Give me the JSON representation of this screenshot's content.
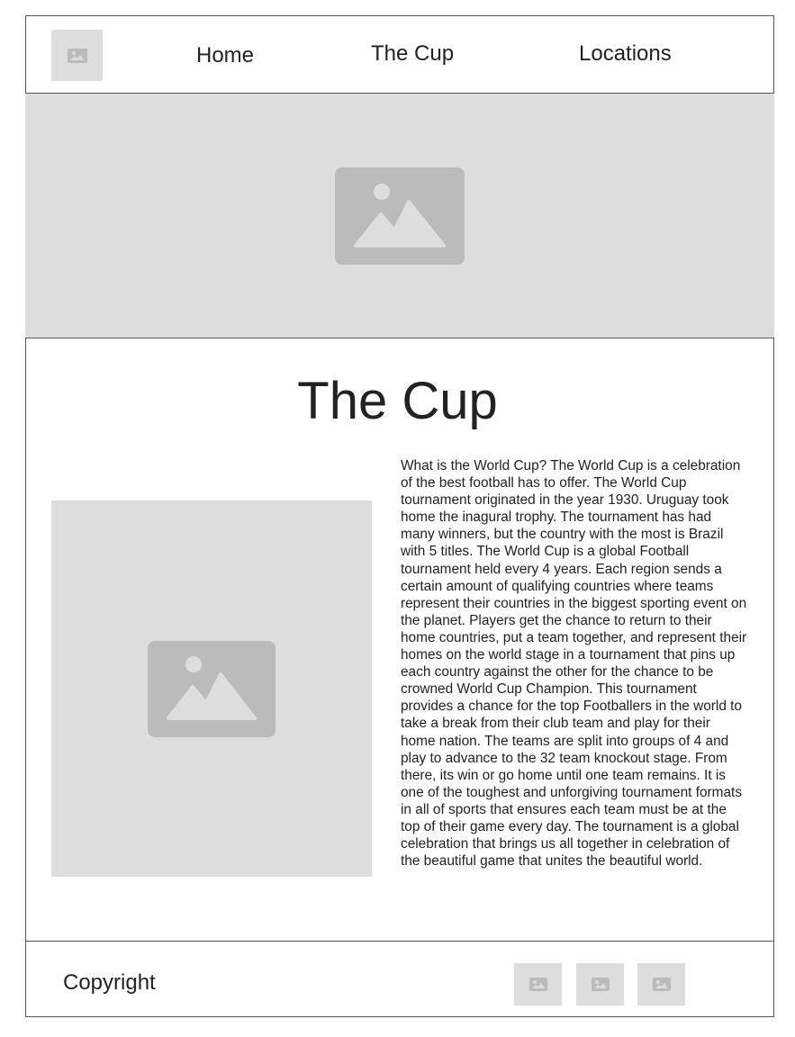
{
  "header": {
    "logo_icon": "image-placeholder-icon",
    "nav": [
      {
        "label": "Home"
      },
      {
        "label": "The Cup"
      },
      {
        "label": "Locations"
      }
    ]
  },
  "hero": {
    "icon": "image-placeholder-icon"
  },
  "main": {
    "title": "The Cup",
    "image_icon": "image-placeholder-icon",
    "body": "What is the World Cup? The World Cup is a celebration of the best football has to offer. The World Cup tournament originated in the year 1930. Uruguay took home the inagural trophy. The tournament has had many winners, but the country with the most is Brazil with 5 titles. The World Cup is a global Football tournament held every 4 years. Each region sends a certain amount of qualifying countries where teams represent their countries in the biggest sporting event on the planet. Players get the chance to return to their home countries, put a team together, and represent their homes on the world stage in a tournament that pins up each country against the other for the chance to be crowned World Cup Champion. This tournament provides a chance for the top Footballers in the world to take a break from their club team and play for their home nation. The teams are split into groups of 4 and play to advance to the 32 team knockout stage. From there, its win or go home until one team remains. It is one of the toughest and unforgiving tournament formats in all of sports that ensures each team must be at the top of their game every day. The tournament is a global celebration that brings us all together in celebration of the beautiful game that unites the beautiful world."
  },
  "footer": {
    "copyright": "Copyright",
    "social_icons": [
      "image-placeholder-icon",
      "image-placeholder-icon",
      "image-placeholder-icon"
    ]
  },
  "colors": {
    "placeholder_bg": "#dddddd",
    "placeholder_icon": "#bbbbbb",
    "border": "#555555"
  }
}
